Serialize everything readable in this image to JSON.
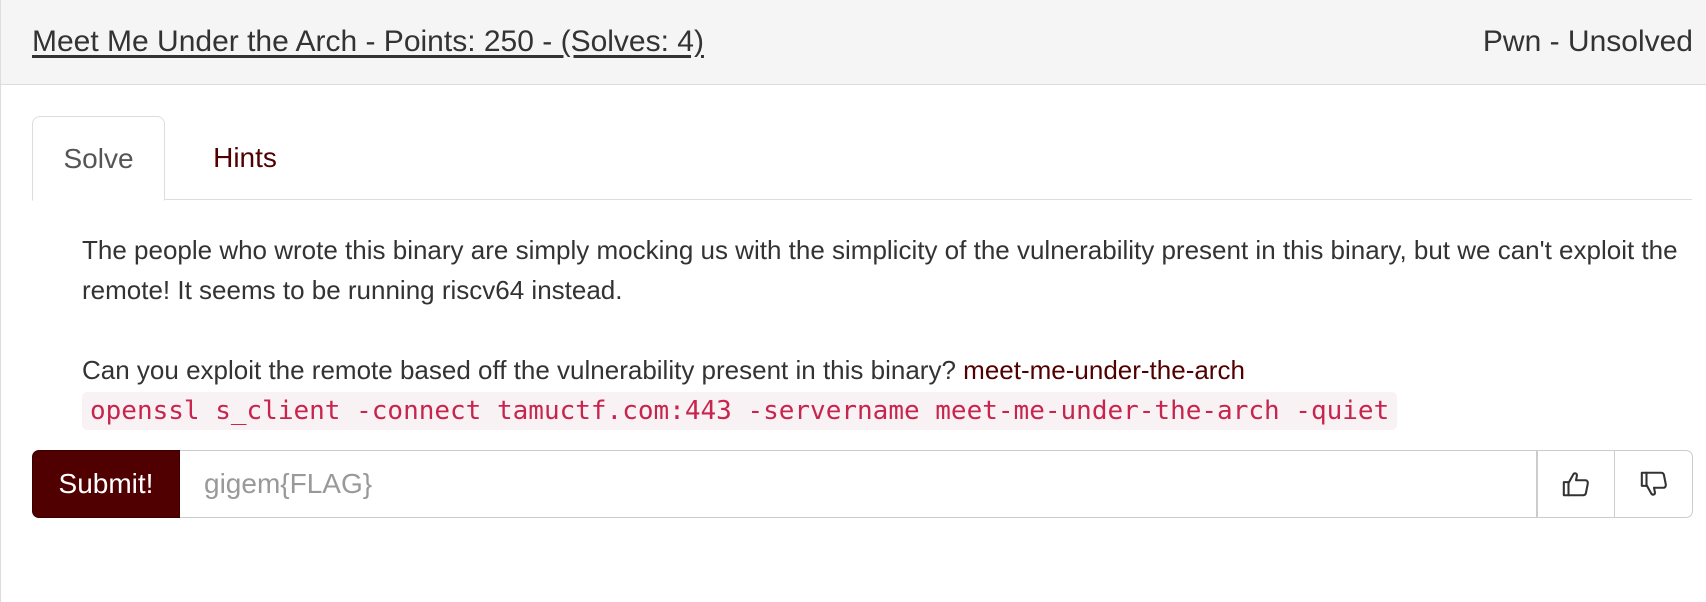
{
  "header": {
    "title": "Meet Me Under the Arch - Points: 250 - (Solves: 4)",
    "status": "Pwn - Unsolved"
  },
  "tabs": [
    {
      "label": "Solve",
      "active": true
    },
    {
      "label": "Hints",
      "active": false
    }
  ],
  "description": {
    "paragraph1": "The people who wrote this binary are simply mocking us with the simplicity of the vulnerability present in this binary, but we can't exploit the remote! It seems to be running riscv64 instead.",
    "paragraph2": "Can you exploit the remote based off the vulnerability present in this binary?",
    "file_link": "meet-me-under-the-arch",
    "command": "openssl s_client -connect tamuctf.com:443 -servername meet-me-under-the-arch -quiet"
  },
  "submit": {
    "button_label": "Submit!",
    "input_placeholder": "gigem{FLAG}",
    "input_value": ""
  },
  "votes": {
    "up_icon": "thumbs-up-icon",
    "down_icon": "thumbs-down-icon"
  },
  "colors": {
    "brand": "#500000",
    "code_text": "#c7254e",
    "code_bg": "#f9f2f4"
  }
}
